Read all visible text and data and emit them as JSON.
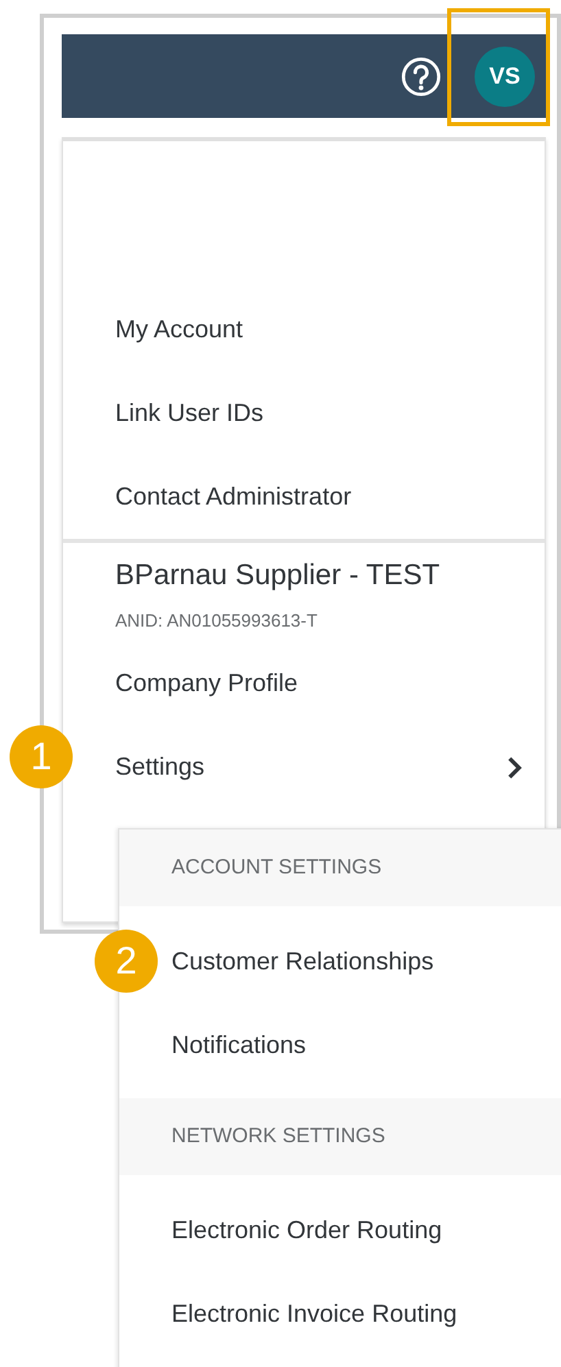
{
  "header": {
    "avatar": "VS",
    "avatar_highlighted": true
  },
  "menu": {
    "sections": [
      {
        "items": [
          {
            "label": "My Account",
            "has_submenu": false
          },
          {
            "label": "Link User IDs",
            "has_submenu": false
          },
          {
            "label": "Contact Administrator",
            "has_submenu": false
          }
        ]
      },
      {
        "title": "BParnau Supplier - TEST",
        "subtitle": "ANID: AN01055993613-T",
        "items": [
          {
            "label": "Company Profile",
            "has_submenu": false
          },
          {
            "label": "Settings",
            "has_submenu": true,
            "callout": "1"
          }
        ]
      }
    ]
  },
  "submenu": {
    "groups": [
      {
        "heading": "ACCOUNT SETTINGS",
        "items": [
          {
            "label": "Customer Relationships",
            "callout": "2"
          },
          {
            "label": "Notifications"
          }
        ]
      },
      {
        "heading": "NETWORK SETTINGS",
        "items": [
          {
            "label": "Electronic Order Routing"
          },
          {
            "label": "Electronic Invoice Routing"
          }
        ]
      }
    ]
  }
}
